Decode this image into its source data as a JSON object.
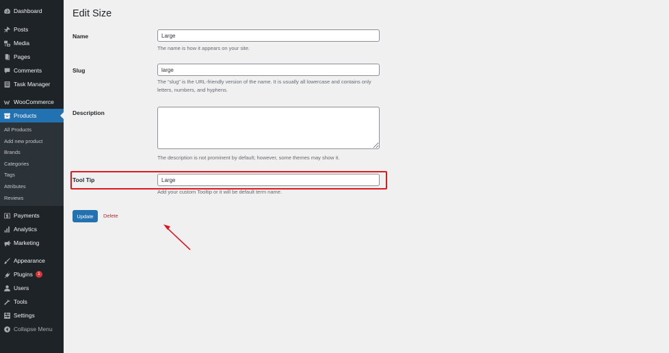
{
  "sidebar": {
    "items_top": [
      {
        "label": "Dashboard",
        "icon": "dashboard-icon"
      },
      {
        "label": "Posts",
        "icon": "pin-icon"
      },
      {
        "label": "Media",
        "icon": "media-icon"
      },
      {
        "label": "Pages",
        "icon": "page-icon"
      },
      {
        "label": "Comments",
        "icon": "comment-icon"
      },
      {
        "label": "Task Manager",
        "icon": "list-icon"
      },
      {
        "label": "WooCommerce",
        "icon": "woo-icon"
      },
      {
        "label": "Products",
        "icon": "archive-icon"
      }
    ],
    "submenu": [
      "All Products",
      "Add new product",
      "Brands",
      "Categories",
      "Tags",
      "Attributes",
      "Reviews"
    ],
    "items_bottom": [
      {
        "label": "Payments",
        "icon": "dollar-icon"
      },
      {
        "label": "Analytics",
        "icon": "bar-chart-icon"
      },
      {
        "label": "Marketing",
        "icon": "megaphone-icon"
      },
      {
        "label": "Appearance",
        "icon": "brush-icon"
      },
      {
        "label": "Plugins",
        "icon": "plugin-icon",
        "badge": "1"
      },
      {
        "label": "Users",
        "icon": "user-icon"
      },
      {
        "label": "Tools",
        "icon": "wrench-icon"
      },
      {
        "label": "Settings",
        "icon": "settings-icon"
      },
      {
        "label": "Collapse Menu",
        "icon": "collapse-icon"
      }
    ]
  },
  "main": {
    "title": "Edit Size",
    "name": {
      "label": "Name",
      "value": "Large",
      "description": "The name is how it appears on your site."
    },
    "slug": {
      "label": "Slug",
      "value": "large",
      "description": "The “slug” is the URL-friendly version of the name. It is usually all lowercase and contains only letters, numbers, and hyphens."
    },
    "description": {
      "label": "Description",
      "value": "",
      "description": "The description is not prominent by default; however, some themes may show it."
    },
    "tooltip": {
      "label": "Tool Tip",
      "value": "Large",
      "description": "Add your custom Tooltip or it will be default term name."
    },
    "update_label": "Update",
    "delete_label": "Delete"
  },
  "colors": {
    "sidebar_bg": "#1d2327",
    "accent": "#2271b1",
    "highlight": "#e0161f",
    "delete": "#b32d2e"
  }
}
